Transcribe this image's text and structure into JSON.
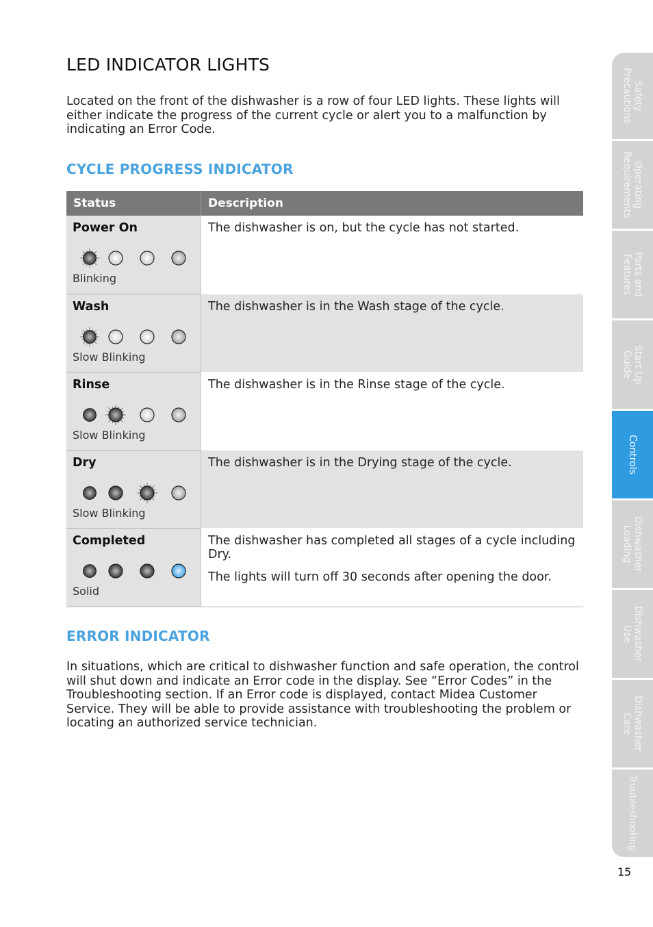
{
  "title": "LED INDICATOR LIGHTS",
  "intro": "Located on the front of the dishwasher is a row of four LED lights. These lights will either indicate the progress of the current cycle or alert you to a malfunction by indicating an Error Code.",
  "cycle_section": {
    "heading": "CYCLE PROGRESS INDICATOR",
    "columns": [
      "Status",
      "Description"
    ],
    "rows": [
      {
        "status": "Power On",
        "mode": "Blinking",
        "leds": [
          "blink-dark",
          "off",
          "off",
          "off-dim"
        ],
        "desc": [
          "The dishwasher is on, but the cycle has not started."
        ]
      },
      {
        "status": "Wash",
        "mode": "Slow Blinking",
        "leds": [
          "blink-dark",
          "off",
          "off",
          "off-dim"
        ],
        "desc": [
          "The dishwasher is in the Wash stage of the cycle."
        ]
      },
      {
        "status": "Rinse",
        "mode": "Slow Blinking",
        "leds": [
          "on-dark",
          "blink-dark",
          "off",
          "off-dim"
        ],
        "desc": [
          "The dishwasher is in the Rinse stage of the cycle."
        ]
      },
      {
        "status": "Dry",
        "mode": "Slow Blinking",
        "leds": [
          "on-dark",
          "on-dark",
          "blink-dark",
          "off-dim"
        ],
        "desc": [
          "The dishwasher is in the Drying stage of the cycle."
        ]
      },
      {
        "status": "Completed",
        "mode": "Solid",
        "leds": [
          "on-dark",
          "on-dark",
          "on-dark",
          "blue"
        ],
        "desc": [
          "The dishwasher has completed all stages of a cycle including Dry.",
          "The lights will turn off 30 seconds after opening the door."
        ]
      }
    ]
  },
  "error_section": {
    "heading": "ERROR INDICATOR",
    "text": "In situations, which are critical to dishwasher function and safe operation, the control will shut down and indicate an Error code in the display. See “Error Codes” in the Troubleshooting section. If an Error code is displayed, contact Midea Customer Service. They will be able to provide assistance with troubleshooting the problem or locating an authorized service technician."
  },
  "side_tabs": [
    {
      "label": "Safety\nPrecautions",
      "active": false
    },
    {
      "label": "Operating\nRequirements",
      "active": false
    },
    {
      "label": "Parts and\nFeatures",
      "active": false
    },
    {
      "label": "Start Up\nGuide",
      "active": false
    },
    {
      "label": "Controls",
      "active": true
    },
    {
      "label": "Dishwasher\nLoading",
      "active": false
    },
    {
      "label": "Dishwasher\nUse",
      "active": false
    },
    {
      "label": "Dishwasher\nCare",
      "active": false
    },
    {
      "label": "Troubleshooting",
      "active": false
    }
  ],
  "page_number": "15",
  "colors": {
    "accent": "#4aa3df",
    "active_tab": "#2f9be0",
    "tab": "#d3d3d3",
    "header": "#7a7879",
    "led_blue": "#5ab4ec"
  }
}
